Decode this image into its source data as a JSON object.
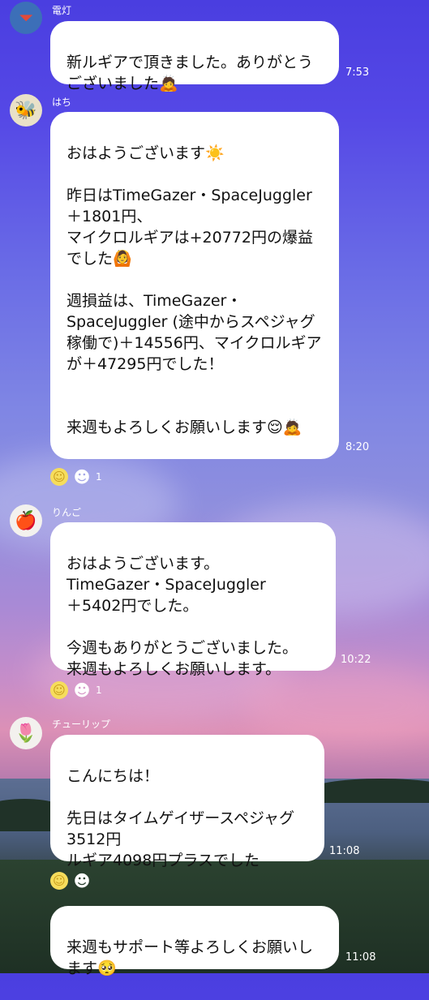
{
  "messages": [
    {
      "sender": "電灯",
      "avatar_icon": "lamp-icon",
      "text": "新ルギアで頂きました。ありがとうございました🙇",
      "time": "7:53"
    },
    {
      "sender": "はち",
      "avatar_icon": "bee-icon",
      "text": "おはようございます☀️\n\n昨日はTimeGazer・SpaceJuggler ＋1801円、\nマイクロルギアは+20772円の爆益でした🙆\n\n週損益は、TimeGazer・SpaceJuggler (途中からスペジャグ稼働で)＋14556円、マイクロルギアが＋47295円でした！\n\n\n来週もよろしくお願いします😌🙇",
      "time": "8:20",
      "reaction_count": "1"
    },
    {
      "sender": "りんご",
      "avatar_icon": "apple-icon",
      "text": "おはようございます。\nTimeGazer・SpaceJuggler\n＋5402円でした。\n\n今週もありがとうございました。\n来週もよろしくお願いします。",
      "time": "10:22",
      "reaction_count": "1"
    },
    {
      "sender": "チューリップ",
      "avatar_icon": "tulip-icon",
      "text": "こんにちは！\n\n先日はタイムゲイザースペジャグ3512円\nルギア4098円プラスでした",
      "time": "11:08"
    },
    {
      "text": "来週もサポート等よろしくお願いします🥺",
      "time": "11:08"
    }
  ],
  "colors": {
    "bubble": "#ffffff",
    "accent": "#4a3ee0"
  }
}
